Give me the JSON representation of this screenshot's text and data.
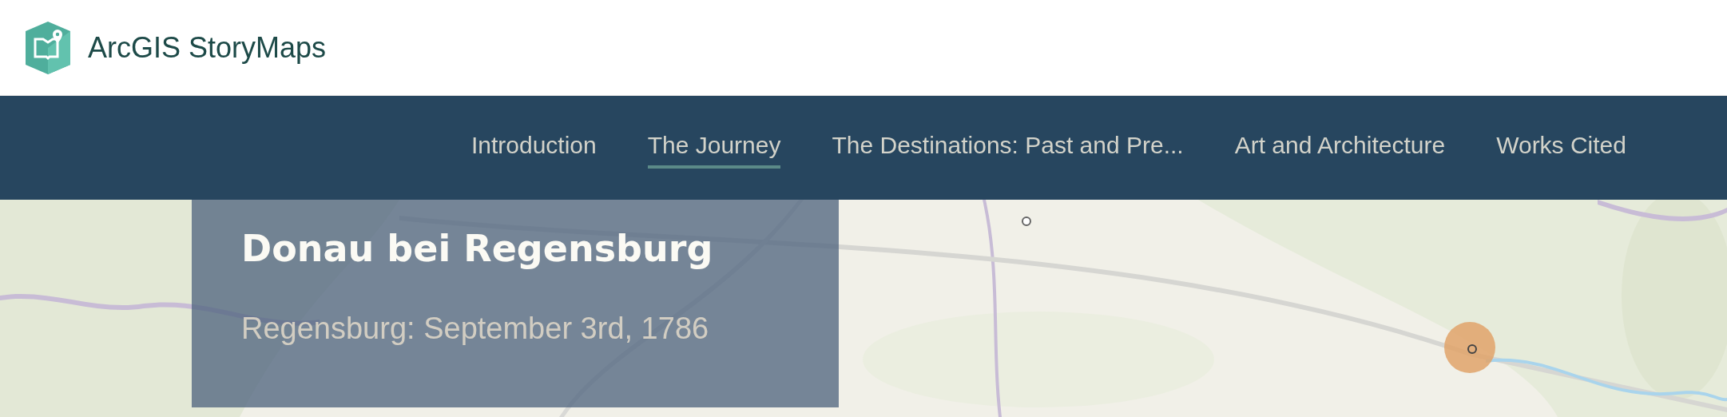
{
  "brand": {
    "name": "ArcGIS StoryMaps"
  },
  "nav": {
    "items": [
      {
        "label": "Introduction",
        "selected": false
      },
      {
        "label": "The Journey",
        "selected": true
      },
      {
        "label": "The Destinations: Past and Pre...",
        "selected": false
      },
      {
        "label": "Art and Architecture",
        "selected": false
      },
      {
        "label": "Works Cited",
        "selected": false
      }
    ]
  },
  "card": {
    "title": "Donau bei Regensburg",
    "subtitle": "Regensburg: September 3rd, 1786"
  }
}
